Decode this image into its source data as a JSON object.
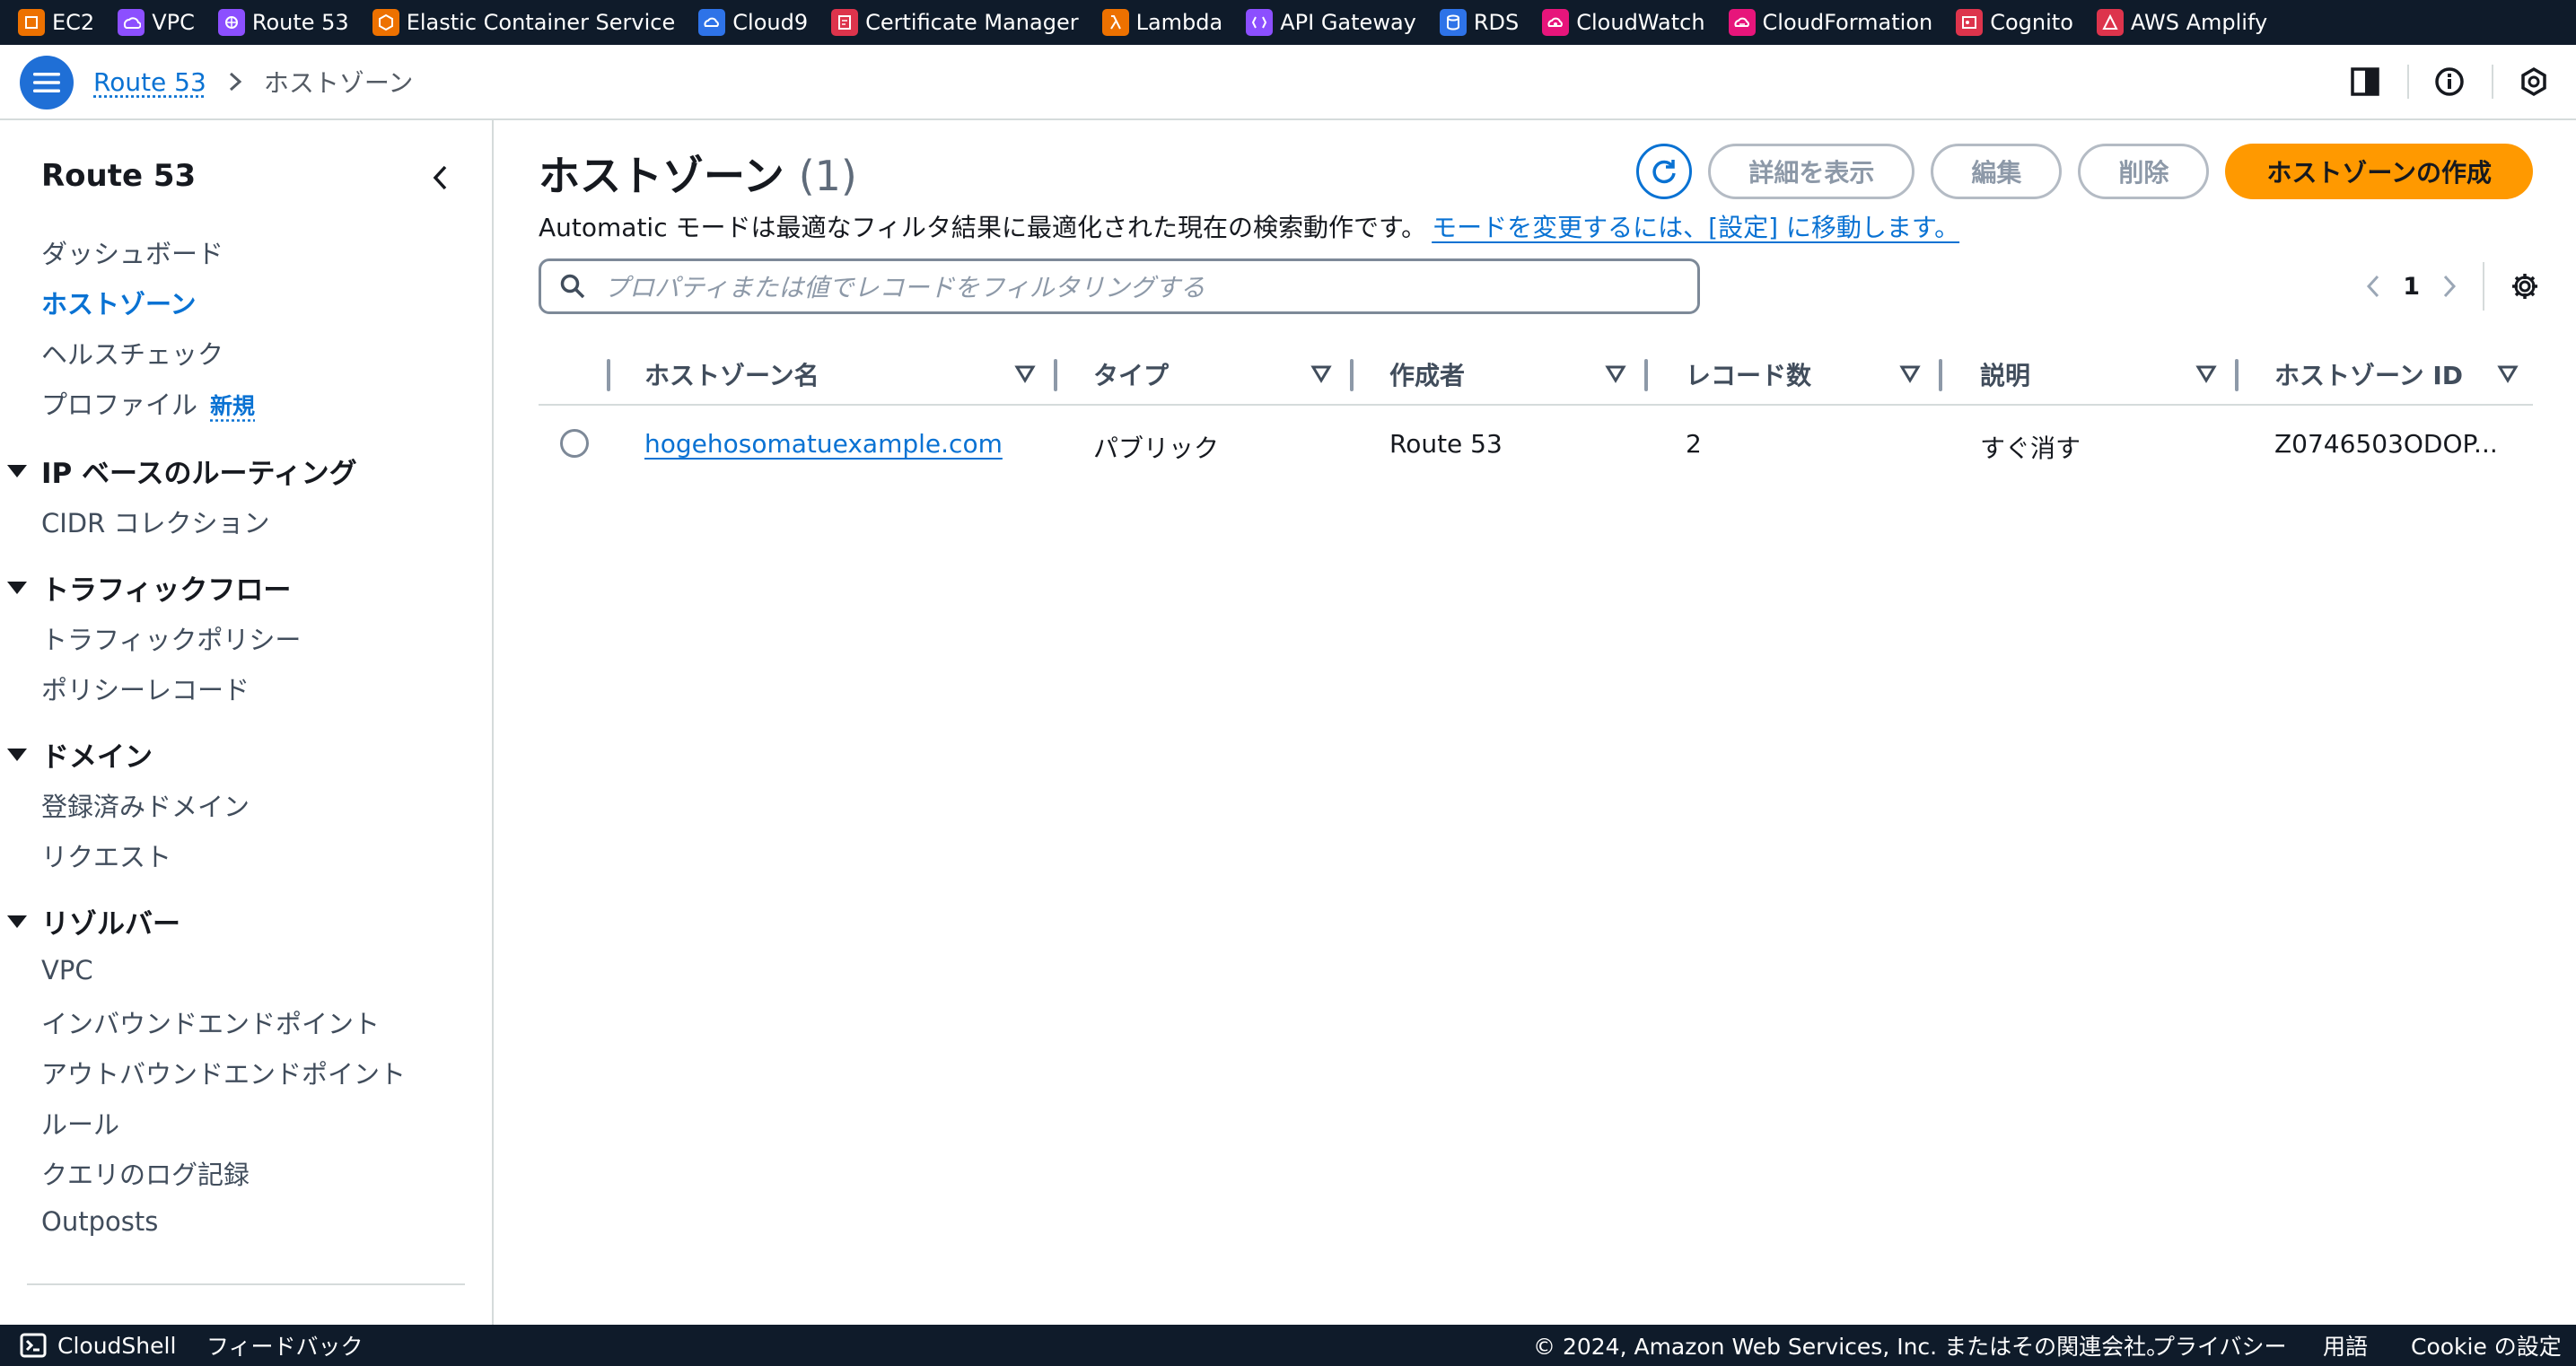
{
  "service_bar": [
    {
      "label": "EC2",
      "icon": "ec2-icon",
      "color": "#ed7100"
    },
    {
      "label": "VPC",
      "icon": "vpc-icon",
      "color": "#8c4fff"
    },
    {
      "label": "Route 53",
      "icon": "route53-icon",
      "color": "#8c4fff"
    },
    {
      "label": "Elastic Container Service",
      "icon": "ecs-icon",
      "color": "#ed7100"
    },
    {
      "label": "Cloud9",
      "icon": "cloud9-icon",
      "color": "#2e73e8"
    },
    {
      "label": "Certificate Manager",
      "icon": "acm-icon",
      "color": "#dd344c"
    },
    {
      "label": "Lambda",
      "icon": "lambda-icon",
      "color": "#ed7100"
    },
    {
      "label": "API Gateway",
      "icon": "api-gateway-icon",
      "color": "#8c4fff"
    },
    {
      "label": "RDS",
      "icon": "rds-icon",
      "color": "#2e73e8"
    },
    {
      "label": "CloudWatch",
      "icon": "cloudwatch-icon",
      "color": "#e7157b"
    },
    {
      "label": "CloudFormation",
      "icon": "cloudformation-icon",
      "color": "#e7157b"
    },
    {
      "label": "Cognito",
      "icon": "cognito-icon",
      "color": "#dd344c"
    },
    {
      "label": "AWS Amplify",
      "icon": "amplify-icon",
      "color": "#dd344c"
    }
  ],
  "breadcrumb": {
    "root": "Route 53",
    "current": "ホストゾーン"
  },
  "sidebar": {
    "title": "Route 53",
    "top_items": [
      "ダッシュボード",
      "ホストゾーン",
      "ヘルスチェック",
      "プロファイル"
    ],
    "new_badge": "新規",
    "sections": [
      {
        "title": "IP ベースのルーティング",
        "items": [
          "CIDR コレクション"
        ]
      },
      {
        "title": "トラフィックフロー",
        "items": [
          "トラフィックポリシー",
          "ポリシーレコード"
        ]
      },
      {
        "title": "ドメイン",
        "items": [
          "登録済みドメイン",
          "リクエスト"
        ]
      },
      {
        "title": "リゾルバー",
        "items": [
          "VPC",
          "インバウンドエンドポイント",
          "アウトバウンドエンドポイント",
          "ルール",
          "クエリのログ記録",
          "Outposts"
        ]
      }
    ]
  },
  "main": {
    "title": "ホストゾーン",
    "count": "(1)",
    "description": "Automatic モードは最適なフィルタ結果に最適化された現在の検索動作です。",
    "description_link": "モードを変更するには、[設定] に移動します。",
    "buttons": {
      "view_details": "詳細を表示",
      "edit": "編集",
      "delete": "削除",
      "create": "ホストゾーンの作成"
    },
    "search_placeholder": "プロパティまたは値でレコードをフィルタリングする",
    "page": "1",
    "columns": [
      "ホストゾーン名",
      "タイプ",
      "作成者",
      "レコード数",
      "説明",
      "ホストゾーン ID"
    ],
    "rows": [
      {
        "name": "hogehosomatuexample.com",
        "type": "パブリック",
        "created_by": "Route 53",
        "record_count": "2",
        "description": "すぐ消す",
        "zone_id": "Z0746503ODOP..."
      }
    ]
  },
  "footer": {
    "cloudshell": "CloudShell",
    "feedback": "フィードバック",
    "copyright": "© 2024, Amazon Web Services, Inc. またはその関連会社。",
    "privacy": "プライバシー",
    "terms": "用語",
    "cookie": "Cookie の設定"
  }
}
